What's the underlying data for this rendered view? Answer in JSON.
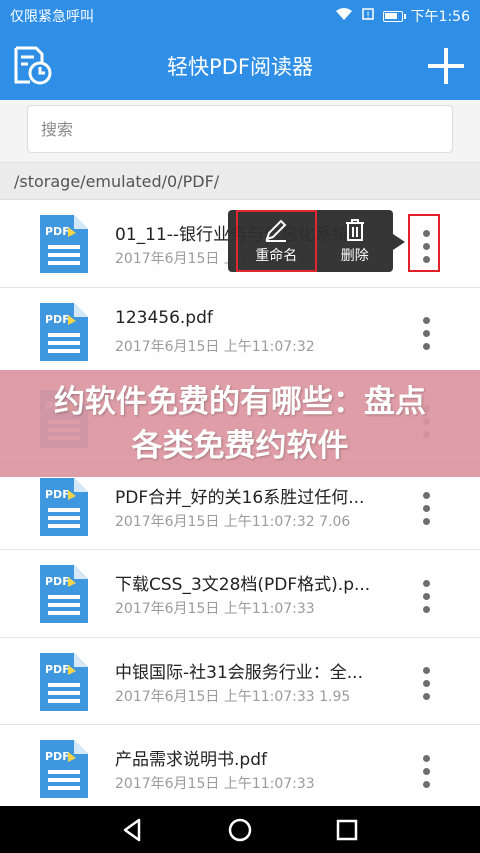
{
  "status_bar": {
    "left_text": "仅限紧急呼叫",
    "time": "下午1:56",
    "battery_level": 0.8
  },
  "app_bar": {
    "title": "轻快PDF阅读器",
    "history_icon": "history-document-icon",
    "add_icon": "plus-icon"
  },
  "search": {
    "placeholder": "搜索",
    "value": ""
  },
  "path": "/storage/emulated/0/PDF/",
  "popup": {
    "rename_label": "重命名",
    "delete_label": "删除"
  },
  "files": [
    {
      "name": "01_11--银行业务与信息化系统...",
      "meta": "2017年6月15日  上午11:07:32  2"
    },
    {
      "name": "123456.pdf",
      "meta": "2017年6月15日  上午11:07:32"
    },
    {
      "name": "",
      "meta": ""
    },
    {
      "name": "PDF合并_好的关16系胜过任何...",
      "meta": "2017年6月15日  上午11:07:32   7.06"
    },
    {
      "name": "下载CSS_3文28档(PDF格式).p...",
      "meta": "2017年6月15日  上午11:07:33"
    },
    {
      "name": "中银国际-社31会服务行业：全...",
      "meta": "2017年6月15日  上午11:07:33   1.95"
    },
    {
      "name": "产品需求说明书.pdf",
      "meta": "2017年6月15日  上午11:07:33"
    }
  ],
  "overlay": {
    "text": "约软件免费的有哪些：盘点各类免费约软件"
  },
  "colors": {
    "primary": "#2f8fe6",
    "highlight": "#e0202a",
    "overlay": "#dc96a0"
  }
}
